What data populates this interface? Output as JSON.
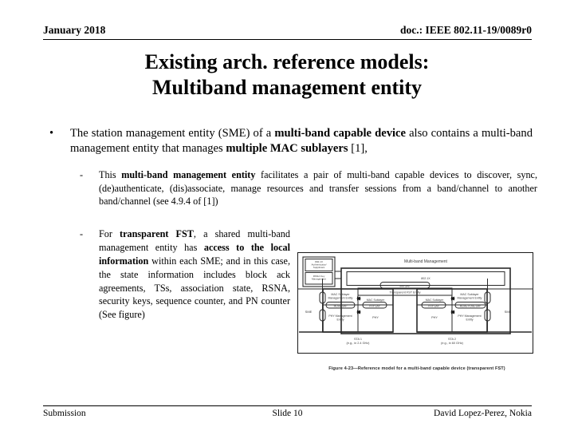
{
  "header": {
    "date": "January 2018",
    "doc_id": "doc.: IEEE 802.11-19/0089r0"
  },
  "title": {
    "line1": "Existing arch. reference models:",
    "line2": "Multiband management entity"
  },
  "content": {
    "bullet_marker": "•",
    "sub_marker": "-",
    "bullet1": {
      "p1": "The station management entity (SME) of a ",
      "b1": "multi-band capable device",
      "p2": " also contains a multi-band management entity that manages ",
      "b2": "multiple MAC sublayers",
      "p3": " [1],"
    },
    "sub1": {
      "p1": "This ",
      "b1": "multi-band management entity",
      "p2": " facilitates a pair of multi-band capable devices to discover, sync, (de)authenticate, (dis)associate, manage resources and transfer sessions from a band/channel to another band/channel (see 4.9.4 of [1])"
    },
    "sub2": {
      "p1": "For ",
      "b1": "transparent FST",
      "p2": ", a shared multi-band management entity has ",
      "b2": "access to the local information",
      "p3": " within each SME; and in this case, the state information includes block ack agreements, TSs, association state, RSNA, security keys, sequence counter, and PN counter (See figure)"
    }
  },
  "figure": {
    "caption": "Figure 4-23—Reference model for a multi-band capable device (transparent FST)",
    "labels": {
      "auth_box": [
        "802.1X",
        "Authenticator/",
        "Supplicant"
      ],
      "rsna_box": [
        "RSNA Key",
        "Management"
      ],
      "multiband_mgmt": "Multi-band Management",
      "dot1x": "802.1X",
      "mm_sap": "MM-SAP",
      "transparent_fst": "Transparent FST Entity",
      "sme_left": "SME",
      "sme_right": "SME",
      "mac_sublayer_mgmt_left": [
        "MAC Sublayer",
        "Management Entity"
      ],
      "mac_sublayer_mgmt_right": [
        "MAC Sublayer",
        "Management Entity"
      ],
      "mac_sublayer_left": "MAC Sublayer",
      "mac_sublayer_right": "MAC Sublayer",
      "mlme_sap": "MLME-SAP",
      "phy_sap_left": "PHY-SAP",
      "phy_sap_right": "PHY-SAP",
      "mlme_plme_sap": "MLME-PLME-SAP",
      "phy_mgmt_left": [
        "PHY Management",
        "Entity"
      ],
      "phy_mgmt_right": [
        "PHY Management",
        "Entity"
      ],
      "phy_left": "PHY",
      "phy_right": "PHY",
      "sta1": "STA 1",
      "sta1_sub": "(e.g., in 2.4 GHz)",
      "sta2": "STA 2",
      "sta2_sub": "(e.g., in 60 GHz)"
    }
  },
  "footer": {
    "left": "Submission",
    "middle": "Slide 10",
    "right": "David Lopez-Perez, Nokia"
  }
}
